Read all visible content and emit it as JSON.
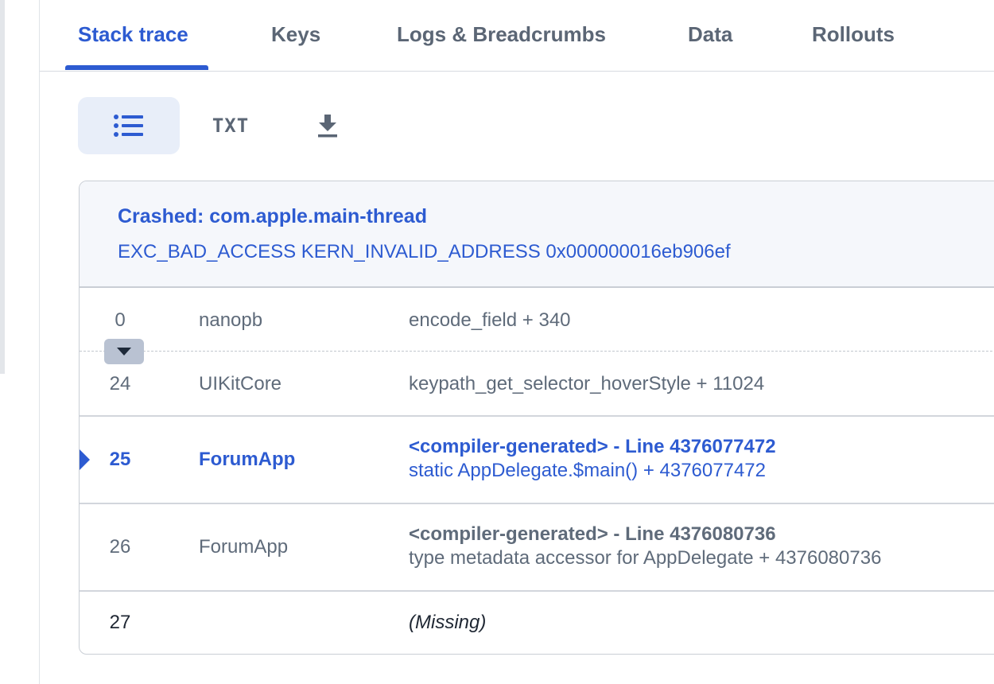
{
  "tabs": [
    {
      "label": "Stack trace",
      "active": true
    },
    {
      "label": "Keys",
      "active": false
    },
    {
      "label": "Logs & Breadcrumbs",
      "active": false
    },
    {
      "label": "Data",
      "active": false
    },
    {
      "label": "Rollouts",
      "active": false
    }
  ],
  "toolbar": {
    "list_view_icon": "list-icon",
    "txt_label": "TXT",
    "download_icon": "download-icon"
  },
  "crash": {
    "title": "Crashed: com.apple.main-thread",
    "description": "EXC_BAD_ACCESS KERN_INVALID_ADDRESS 0x000000016eb906ef"
  },
  "frames": [
    {
      "index": "0",
      "library": "nanopb",
      "symbol": "encode_field + 340"
    },
    {
      "index": "24",
      "library": "UIKitCore",
      "symbol": "keypath_get_selector_hoverStyle + 11024"
    },
    {
      "index": "25",
      "library": "ForumApp",
      "symbol_title": "<compiler-generated> - Line 4376077472",
      "symbol": "static AppDelegate.$main() + 4376077472",
      "highlighted": true
    },
    {
      "index": "26",
      "library": "ForumApp",
      "symbol_title": "<compiler-generated> - Line 4376080736",
      "symbol": "type metadata accessor for AppDelegate + 4376080736"
    },
    {
      "index": "27",
      "library": "",
      "symbol": "(Missing)"
    }
  ],
  "colors": {
    "accent": "#2d5bd1",
    "text_muted": "#5f6b7a",
    "header_bg": "#f5f7fb",
    "active_btn_bg": "#e8eef9"
  }
}
